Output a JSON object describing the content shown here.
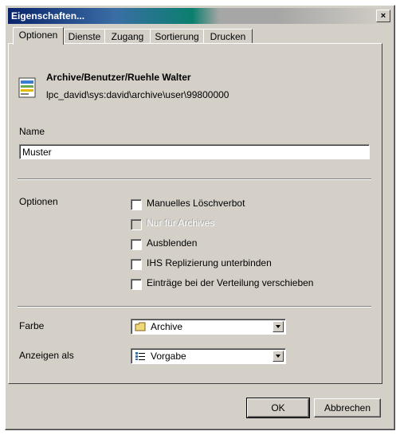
{
  "window": {
    "title": "Eigenschaften...",
    "close_glyph": "×"
  },
  "tabs": [
    {
      "label": "Optionen"
    },
    {
      "label": "Dienste"
    },
    {
      "label": "Zugang"
    },
    {
      "label": "Sortierung"
    },
    {
      "label": "Drucken"
    }
  ],
  "header": {
    "icon": "document-icon",
    "title": "Archive/Benutzer/Ruehle Walter",
    "path": "lpc_david\\sys:david\\archive\\user\\99800000"
  },
  "name_field": {
    "label": "Name",
    "value": "Muster"
  },
  "options": {
    "label": "Optionen",
    "items": [
      {
        "label": "Manuelles Löschverbot",
        "checked": false,
        "enabled": true
      },
      {
        "label": "Nur für Archives",
        "checked": false,
        "enabled": false
      },
      {
        "label": "Ausblenden",
        "checked": false,
        "enabled": true
      },
      {
        "label": "IHS Replizierung unterbinden",
        "checked": false,
        "enabled": true
      },
      {
        "label": "Einträge bei der Verteilung verschieben",
        "checked": false,
        "enabled": true
      }
    ]
  },
  "farbe": {
    "label": "Farbe",
    "value": "Archive",
    "icon": "folder-icon"
  },
  "anzeigen": {
    "label": "Anzeigen als",
    "value": "Vorgabe",
    "icon": "list-view-icon"
  },
  "buttons": {
    "ok": "OK",
    "cancel": "Abbrechen"
  },
  "colors": {
    "face": "#d4d0c8",
    "title_start": "#0a246a",
    "title_mid": "#0a7f6e"
  }
}
